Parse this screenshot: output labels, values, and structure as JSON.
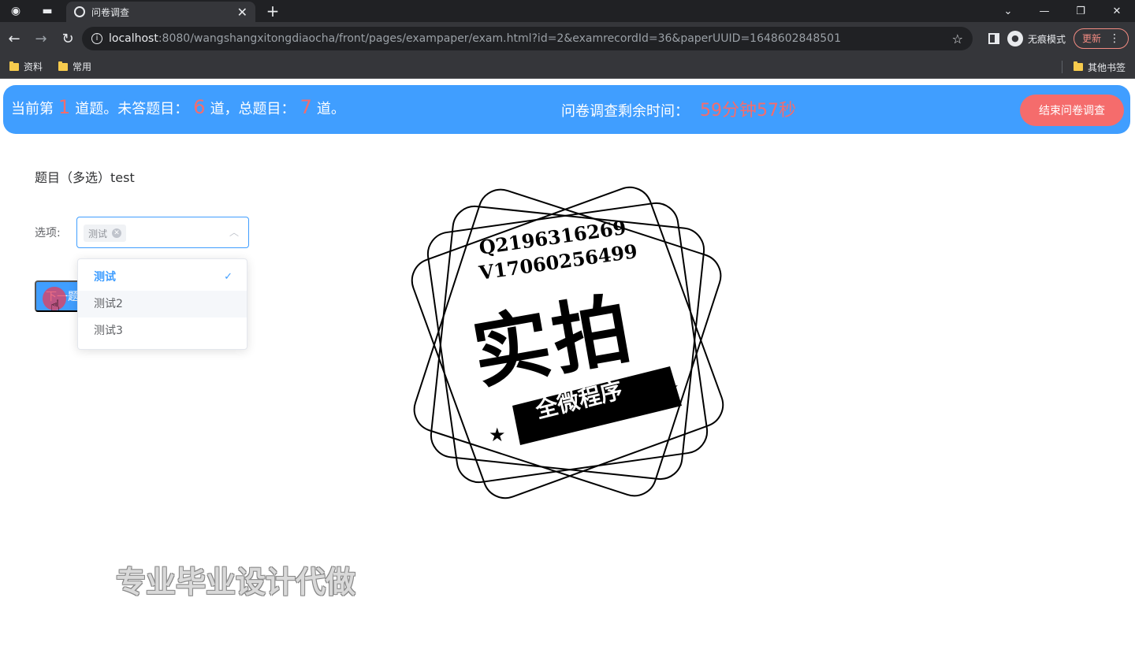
{
  "browser": {
    "tab_title": "问卷调查",
    "url_host": "localhost",
    "url_path": ":8080/wangshangxitongdiaocha/front/pages/exampaper/exam.html?id=2&examrecordId=36&paperUUID=1648602848501",
    "incognito_label": "无痕模式",
    "update_label": "更新",
    "bookmarks": [
      "资料",
      "常用"
    ],
    "other_bookmarks": "其他书签"
  },
  "status": {
    "prefix": "当前第",
    "current": "1",
    "mid1": "道题。未答题目：",
    "unanswered": "6",
    "mid2": "道，总题目：",
    "total": "7",
    "suffix": "道。",
    "time_label": "问卷调查剩余时间：",
    "time_value": "59分钟57秒",
    "end_button": "结束问卷调查"
  },
  "question": {
    "title": "题目（多选）test",
    "option_label": "选项:",
    "selected_tag": "测试",
    "next_button": "下一题"
  },
  "dropdown": {
    "options": [
      "测试",
      "测试2",
      "测试3"
    ]
  },
  "watermark": {
    "qq": "Q2196316269",
    "vx": "V17060256499",
    "big": "实拍",
    "ribbon": "全微程序",
    "bottom": "专业毕业设计代做"
  }
}
